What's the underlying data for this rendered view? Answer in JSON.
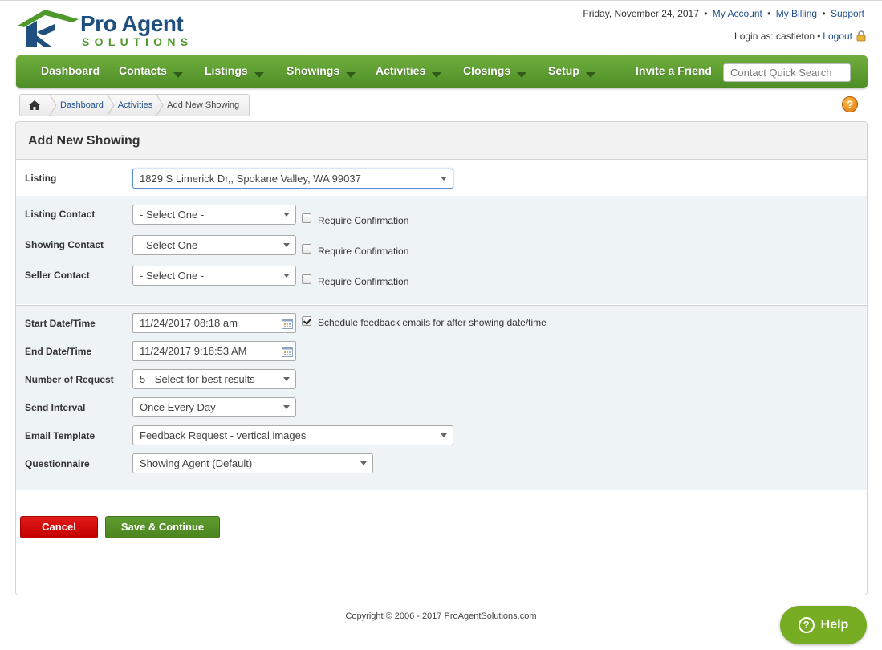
{
  "header": {
    "brand_top": "Pro Agent",
    "brand_bottom": "SOLUTIONS",
    "date": "Friday, November 24, 2017",
    "my_account": "My Account",
    "my_billing": "My Billing",
    "support": "Support",
    "separator": "•",
    "login_as": "Login as: castleton",
    "logout": "Logout"
  },
  "nav": {
    "items": [
      {
        "label": "Dashboard"
      },
      {
        "label": "Contacts"
      },
      {
        "label": "Listings"
      },
      {
        "label": "Showings"
      },
      {
        "label": "Activities"
      },
      {
        "label": "Closings"
      },
      {
        "label": "Setup"
      }
    ],
    "invite": "Invite a Friend",
    "search_placeholder": "Contact Quick Search"
  },
  "breadcrumb": {
    "dashboard": "Dashboard",
    "activities": "Activities",
    "current": "Add New Showing"
  },
  "help_icon": "?",
  "form": {
    "title": "Add New Showing",
    "listing_label": "Listing",
    "listing_value": "1829 S Limerick Dr,, Spokane Valley, WA 99037",
    "listing_contact_label": "Listing Contact",
    "showing_contact_label": "Showing Contact",
    "seller_contact_label": "Seller Contact",
    "select_one": "- Select One -",
    "require_confirmation": "Require Confirmation",
    "start_label": "Start Date/Time",
    "start_value": "11/24/2017 08:18 am",
    "schedule_feedback": "Schedule feedback emails for after showing date/time",
    "end_label": "End Date/Time",
    "end_value": "11/24/2017 9:18:53 AM",
    "num_request_label": "Number of Request",
    "num_request_value": "5 - Select for best results",
    "send_interval_label": "Send Interval",
    "send_interval_value": "Once Every Day",
    "email_template_label": "Email Template",
    "email_template_value": "Feedback Request - vertical images",
    "questionnaire_label": "Questionnaire",
    "questionnaire_value": "Showing Agent (Default)",
    "cancel": "Cancel",
    "save": "Save & Continue"
  },
  "footer": {
    "copyright": "Copyright © 2006 - 2017 ProAgentSolutions.com"
  },
  "help_button": {
    "label": "Help",
    "glyph": "?"
  },
  "colors": {
    "nav_green": "#5b9c30",
    "cancel_red": "#d40a0a",
    "save_green": "#568e28",
    "help_green": "#77ad22"
  }
}
